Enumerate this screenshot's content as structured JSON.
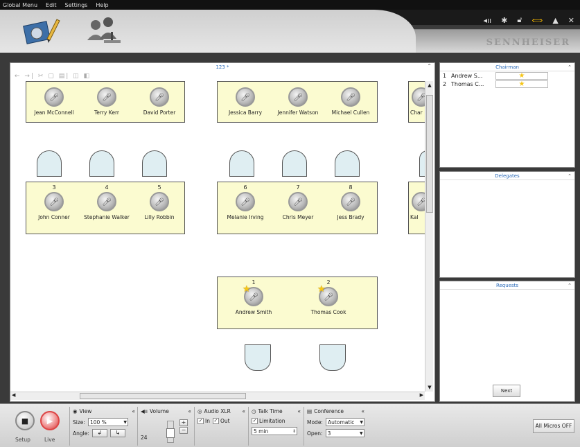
{
  "menu": [
    "Global Menu",
    "Edit",
    "Settings",
    "Help"
  ],
  "brand": "SENNHEISER",
  "top_icons": [
    "signal-icon",
    "gear-icon",
    "unlock-icon",
    "swap-icon",
    "eject-icon",
    "close-icon"
  ],
  "plan": {
    "title": "123 *",
    "tables": [
      {
        "seats": [
          {
            "num": "",
            "name": "Jean McConnell",
            "star": false
          },
          {
            "num": "",
            "name": "Terry Kerr",
            "star": false
          },
          {
            "num": "",
            "name": "David Porter",
            "star": false
          }
        ]
      },
      {
        "seats": [
          {
            "num": "",
            "name": "Jessica Barry",
            "star": false
          },
          {
            "num": "",
            "name": "Jennifer Watson",
            "star": false
          },
          {
            "num": "",
            "name": "Michael Cullen",
            "star": false
          }
        ]
      },
      {
        "seats": [
          {
            "num": "",
            "name": "Char",
            "star": false
          }
        ]
      },
      {
        "seats": [
          {
            "num": "3",
            "name": "John Conner",
            "star": false
          },
          {
            "num": "4",
            "name": "Stephanie Walker",
            "star": false
          },
          {
            "num": "5",
            "name": "Lilly Robbin",
            "star": false
          }
        ]
      },
      {
        "seats": [
          {
            "num": "6",
            "name": "Melanie Irving",
            "star": false
          },
          {
            "num": "7",
            "name": "Chris Meyer",
            "star": false
          },
          {
            "num": "8",
            "name": "Jess Brady",
            "star": false
          }
        ]
      },
      {
        "seats": [
          {
            "num": "",
            "name": "Kal",
            "star": false
          }
        ]
      },
      {
        "seats": [
          {
            "num": "1",
            "name": "Andrew Smith",
            "star": true
          },
          {
            "num": "2",
            "name": "Thomas Cook",
            "star": true
          }
        ]
      }
    ]
  },
  "chairman": {
    "title": "Chairman",
    "rows": [
      {
        "rank": "1",
        "name": "Andrew S..."
      },
      {
        "rank": "2",
        "name": "Thomas C..."
      }
    ]
  },
  "delegates": {
    "title": "Delegates"
  },
  "requests": {
    "title": "Requests",
    "next_label": "Next"
  },
  "bottom": {
    "setup_label": "Setup",
    "live_label": "Live",
    "view": {
      "title": "View",
      "size_label": "Size:",
      "size_value": "100 %",
      "angle_label": "Angle:"
    },
    "volume": {
      "title": "Volume",
      "value": "24"
    },
    "audio": {
      "title": "Audio XLR",
      "in_label": "In",
      "out_label": "Out"
    },
    "talk": {
      "title": "Talk Time",
      "limitation_label": "Limitation",
      "time_value": "5 min"
    },
    "conference": {
      "title": "Conference",
      "mode_label": "Mode:",
      "mode_value": "Automatic",
      "open_label": "Open:",
      "open_value": "3"
    },
    "all_micros_label": "All Micros OFF"
  }
}
